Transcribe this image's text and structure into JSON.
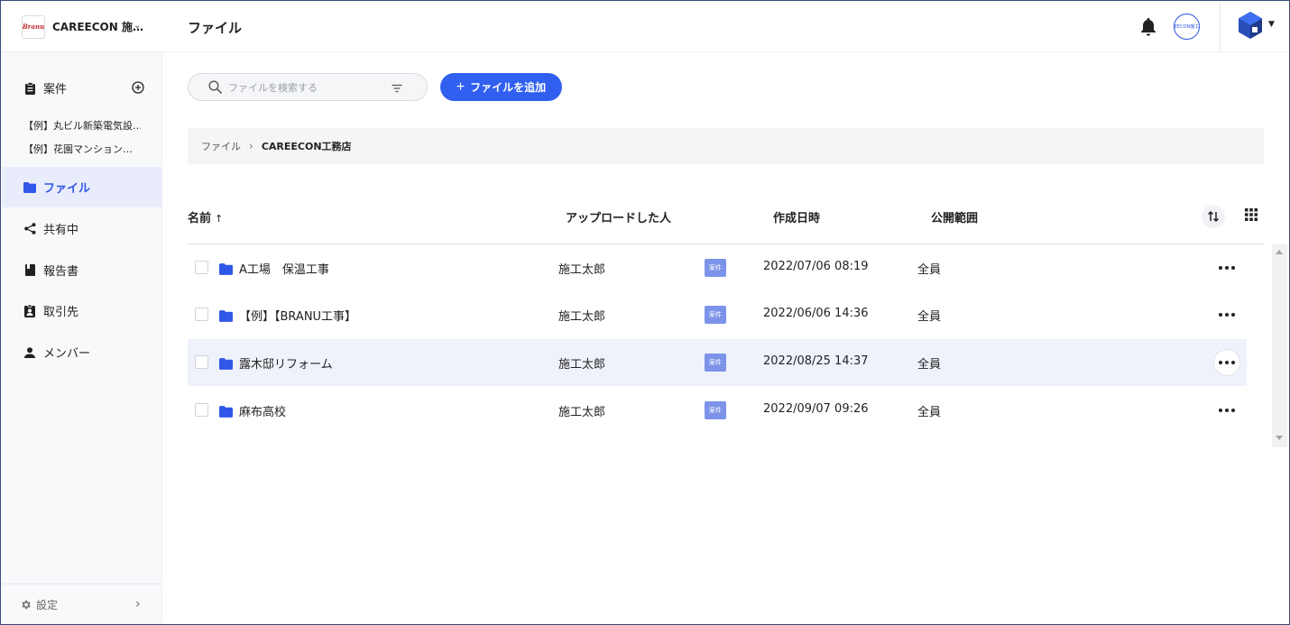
{
  "org": {
    "logo_text": "Branu",
    "name": "CAREECON 施…"
  },
  "sidebar": {
    "cases_label": "案件",
    "case_items": [
      "【例】丸ビル新築電気設…",
      "【例】花園マンション…"
    ],
    "files_label": "ファイル",
    "shared_label": "共有中",
    "reports_label": "報告書",
    "clients_label": "取引先",
    "members_label": "メンバー",
    "settings_label": "設定"
  },
  "header": {
    "title": "ファイル",
    "avatar_text": "EECON施工"
  },
  "toolbar": {
    "search_placeholder": "ファイルを検索する",
    "add_label": "ファイルを追加"
  },
  "breadcrumb": {
    "root": "ファイル",
    "current": "CAREECON工務店"
  },
  "table": {
    "columns": {
      "name": "名前",
      "uploader": "アップロードした人",
      "created": "作成日時",
      "scope": "公開範囲"
    },
    "rows": [
      {
        "name": "A工場　保温工事",
        "uploader": "施工太郎",
        "tag": "案件",
        "created": "2022/07/06 08:19",
        "scope": "全員"
      },
      {
        "name": "【例】【BRANU工事】",
        "uploader": "施工太郎",
        "tag": "案件",
        "created": "2022/06/06 14:36",
        "scope": "全員"
      },
      {
        "name": "露木邸リフォーム",
        "uploader": "施工太郎",
        "tag": "案件",
        "created": "2022/08/25 14:37",
        "scope": "全員"
      },
      {
        "name": "麻布高校",
        "uploader": "施工太郎",
        "tag": "案件",
        "created": "2022/09/07 09:26",
        "scope": "全員"
      }
    ]
  },
  "colors": {
    "accent": "#3160f0",
    "tag": "#7b93e8",
    "active_bg": "#e9edfb"
  }
}
